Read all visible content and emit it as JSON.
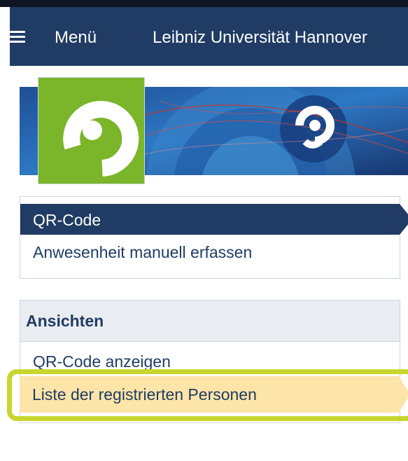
{
  "header": {
    "menu_label": "Menü",
    "title": "Leibniz Universität Hannover",
    "menu_icon": "hamburger-icon"
  },
  "logo": {
    "icon": "ilias-logo"
  },
  "menu1": {
    "active_label": "QR-Code",
    "second_label": "Anwesenheit manuell erfassen"
  },
  "views": {
    "heading": "Ansichten",
    "items": [
      {
        "label": "QR-Code anzeigen"
      },
      {
        "label": "Liste der registrierten Personen"
      }
    ]
  },
  "colors": {
    "nav": "#203c64",
    "active_bg": "#203c64",
    "highlight_bg": "#fde4a8",
    "highlight_border": "#c8d62e",
    "logo_green": "#7ab52a"
  }
}
